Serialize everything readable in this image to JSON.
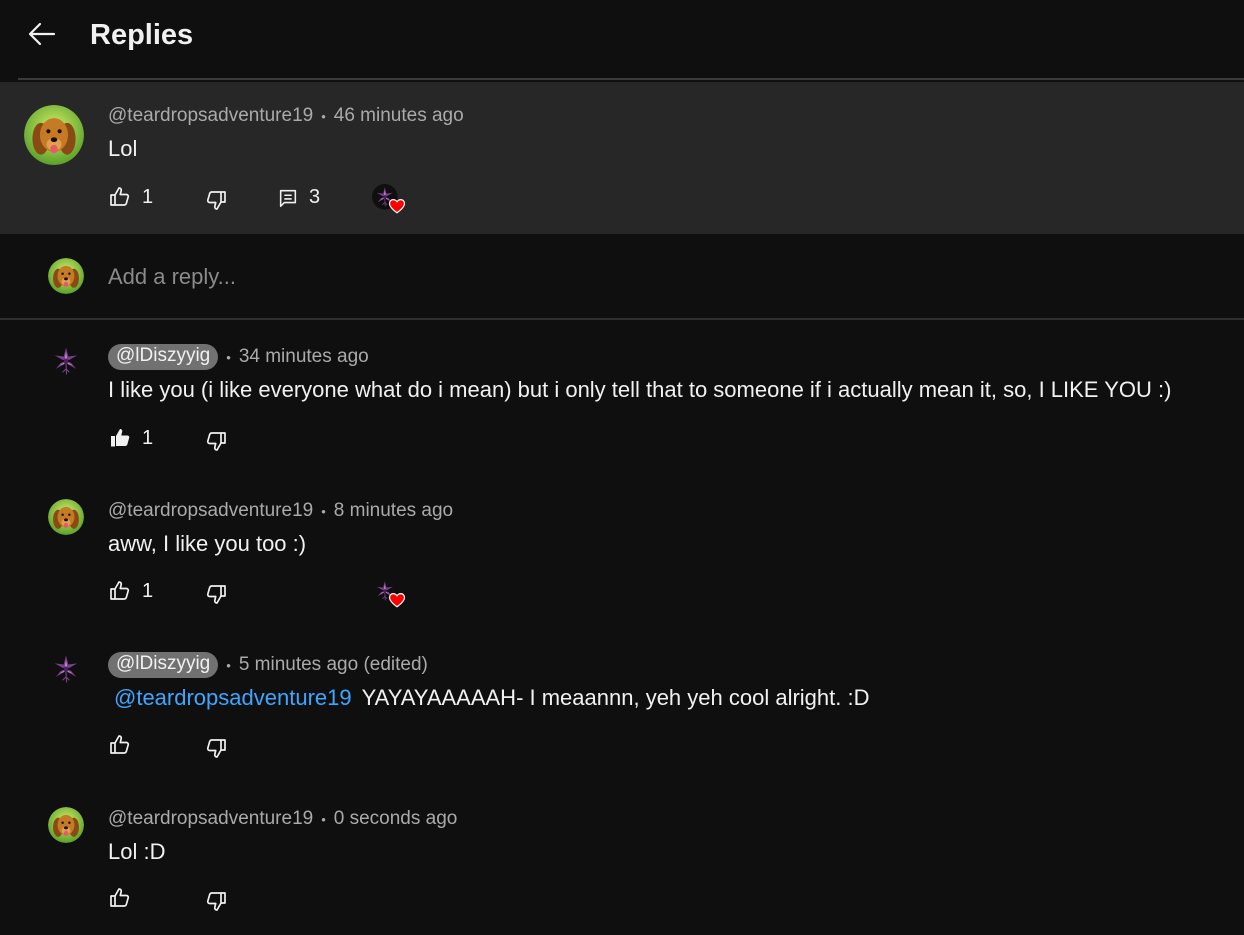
{
  "header": {
    "title": "Replies",
    "back_icon": "arrow-left-icon"
  },
  "parent_comment": {
    "handle": "@teardropsadventure19",
    "time": "46 minutes ago",
    "text": "Lol",
    "likes": "1",
    "replies": "3",
    "hearted": true
  },
  "reply_input": {
    "placeholder": "Add a reply..."
  },
  "replies": [
    {
      "handle": "@lDiszyyig",
      "highlighted_handle": true,
      "time": "34 minutes ago",
      "text": "I like you (i like everyone what do i mean) but i only tell that to someone if i actually mean it, so, I LIKE YOU :)",
      "likes": "1",
      "liked": true
    },
    {
      "handle": "@teardropsadventure19",
      "time": "8 minutes ago",
      "text": "aww, I like you too :)",
      "likes": "1",
      "hearted": true
    },
    {
      "handle": "@lDiszyyig",
      "highlighted_handle": true,
      "time": "5 minutes ago (edited)",
      "mention": "@teardropsadventure19",
      "text": "YAYAYAAAAAH- I meaannn, yeh yeh cool alright. :D",
      "likes": ""
    },
    {
      "handle": "@teardropsadventure19",
      "time": "0 seconds ago",
      "text": "Lol :D",
      "likes": ""
    }
  ],
  "colors": {
    "background": "#0f0f0f",
    "highlight": "#272727",
    "mention": "#3ea6ff",
    "heart": "#ff0000"
  }
}
